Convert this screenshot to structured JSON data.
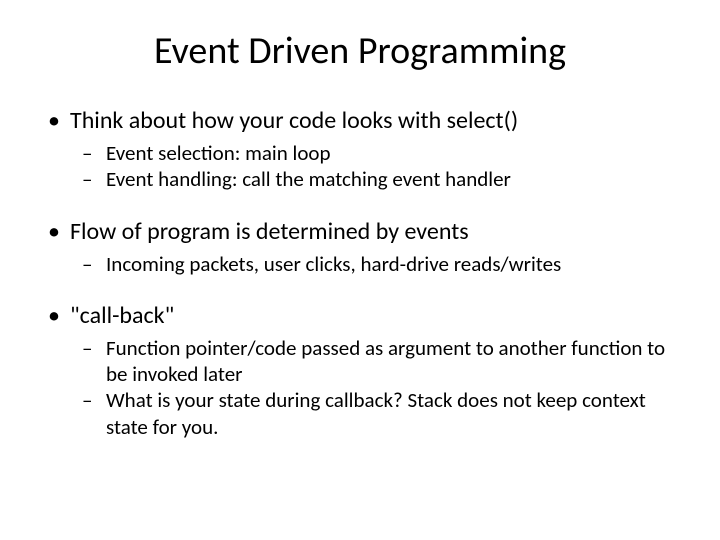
{
  "title": "Event Driven Programming",
  "bullets": [
    {
      "text": "Think about how your code looks with select()",
      "subs": [
        "Event selection: main loop",
        "Event handling: call the matching event handler"
      ]
    },
    {
      "text": "Flow of program is determined by events",
      "subs": [
        "Incoming packets, user clicks, hard-drive reads/writes"
      ]
    },
    {
      "text": "\"call-back\"",
      "subs": [
        "Function pointer/code passed as argument to another function to be invoked later",
        "What is your state during callback? Stack does not keep context state for you."
      ]
    }
  ]
}
